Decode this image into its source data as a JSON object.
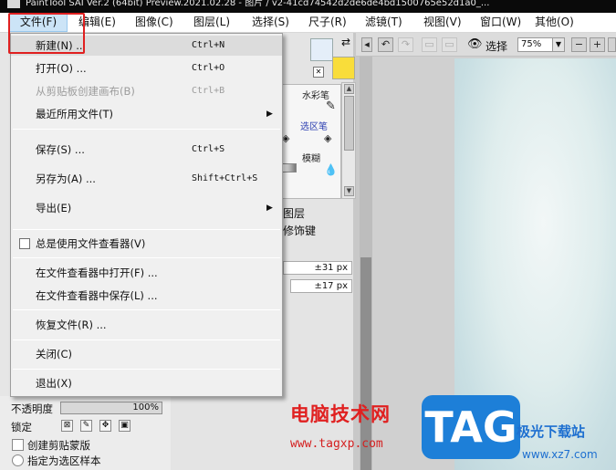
{
  "window": {
    "title": "PaintTool SAI Ver.2 (64bit) Preview.2021.02.28 - 图片 / v2-41cd74542d2de6de4bd1500765e52d1a0_..."
  },
  "menubar": {
    "items": [
      "文件(F)",
      "编辑(E)",
      "图像(C)",
      "图层(L)",
      "选择(S)",
      "尺子(R)",
      "滤镜(T)",
      "视图(V)",
      "窗口(W)",
      "其他(O)"
    ]
  },
  "file_menu": {
    "new": {
      "label": "新建(N) ...",
      "shortcut": "Ctrl+N"
    },
    "open": {
      "label": "打开(O) ...",
      "shortcut": "Ctrl+O"
    },
    "from_clipboard": {
      "label": "从剪贴板创建画布(B)",
      "shortcut": "Ctrl+B"
    },
    "recent": {
      "label": "最近所用文件(T)"
    },
    "save": {
      "label": "保存(S) ...",
      "shortcut": "Ctrl+S"
    },
    "save_as": {
      "label": "另存为(A) ...",
      "shortcut": "Shift+Ctrl+S"
    },
    "export": {
      "label": "导出(E)"
    },
    "always_viewer": {
      "label": "总是使用文件查看器(V)"
    },
    "open_in_viewer": {
      "label": "在文件查看器中打开(F) ..."
    },
    "save_in_viewer": {
      "label": "在文件查看器中保存(L) ..."
    },
    "restore": {
      "label": "恢复文件(R) ..."
    },
    "close": {
      "label": "关闭(C)"
    },
    "exit": {
      "label": "退出(X)"
    }
  },
  "tools": {
    "watercolor": "水彩笔",
    "selection_pen": "选区笔",
    "blur": "模糊",
    "layer_label": "图层",
    "modifier_label": "修饰键"
  },
  "sizes": {
    "size1": "±31 px",
    "size2": "±17 px"
  },
  "layer_panel": {
    "opacity_label": "不透明度",
    "opacity_value": "100%",
    "lock_label": "锁定",
    "clip_label": "创建剪贴蒙版",
    "selection_sample": "指定为选区样本"
  },
  "toolbar": {
    "selection_label": "选择",
    "zoom": "75%"
  },
  "watermark": {
    "site_cn": "电脑技术网",
    "site_url": "www.tagxp.com",
    "tag": "TAG",
    "dl_cn": "极光下载站",
    "dl_url": "www.xz7.com"
  }
}
